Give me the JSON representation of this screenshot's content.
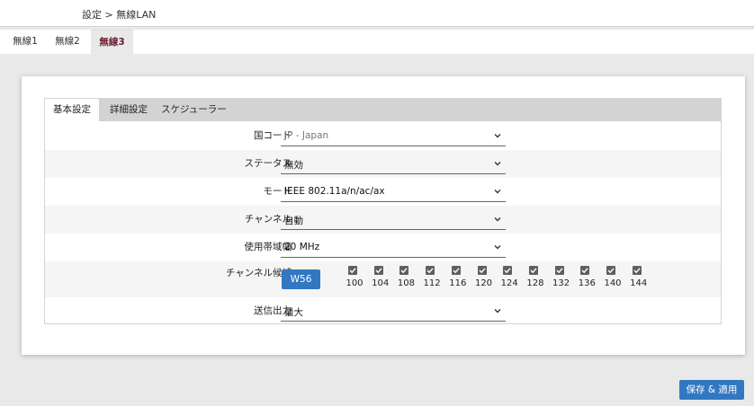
{
  "breadcrumb": "設定 > 無線LAN",
  "tabs": [
    "無線1",
    "無線2",
    "無線3"
  ],
  "active_tab": "無線3",
  "subtabs": [
    "基本設定",
    "詳細設定",
    "スケジューラー"
  ],
  "active_subtab": "基本設定",
  "fields": {
    "country": {
      "label": "国コード",
      "value": "JP - Japan"
    },
    "status": {
      "label": "ステータス",
      "value": "無効"
    },
    "mode": {
      "label": "モード",
      "value": "IEEE 802.11a/n/ac/ax"
    },
    "channel": {
      "label": "チャンネル",
      "value": "自動"
    },
    "bandwidth": {
      "label": "使用帯域幅",
      "value": "20 MHz"
    },
    "channel_candidates": {
      "label": "チャンネル候補",
      "group_button": "W56",
      "channels": [
        {
          "num": "100",
          "checked": true
        },
        {
          "num": "104",
          "checked": true
        },
        {
          "num": "108",
          "checked": true
        },
        {
          "num": "112",
          "checked": true
        },
        {
          "num": "116",
          "checked": true
        },
        {
          "num": "120",
          "checked": true
        },
        {
          "num": "124",
          "checked": true
        },
        {
          "num": "128",
          "checked": true
        },
        {
          "num": "132",
          "checked": true
        },
        {
          "num": "136",
          "checked": true
        },
        {
          "num": "140",
          "checked": true
        },
        {
          "num": "144",
          "checked": true
        }
      ]
    },
    "tx_power": {
      "label": "送信出力",
      "value": "最大"
    }
  },
  "save_button": "保存 & 適用",
  "colors": {
    "primary": "#3278c0",
    "active_tab_text": "#6a1b2e",
    "checkbox": "#5f5f5f"
  }
}
